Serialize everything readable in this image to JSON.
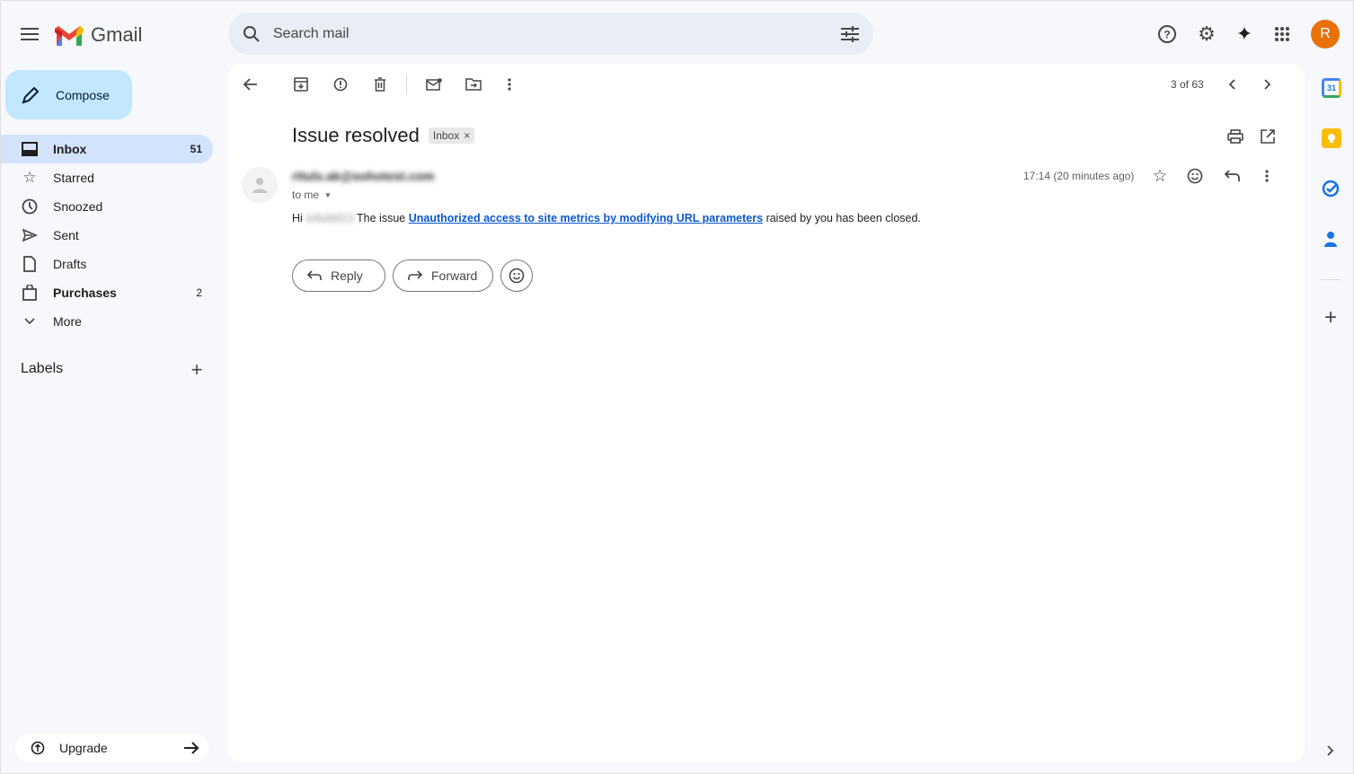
{
  "app": {
    "name": "Gmail",
    "avatar_letter": "R",
    "avatar_color": "#e8710a"
  },
  "search": {
    "placeholder": "Search mail"
  },
  "compose_label": "Compose",
  "sidebar": {
    "items": [
      {
        "label": "Inbox",
        "count": "51",
        "icon": "inbox-icon",
        "active": true
      },
      {
        "label": "Starred",
        "count": "",
        "icon": "star-icon"
      },
      {
        "label": "Snoozed",
        "count": "",
        "icon": "clock-icon"
      },
      {
        "label": "Sent",
        "count": "",
        "icon": "send-icon"
      },
      {
        "label": "Drafts",
        "count": "",
        "icon": "draft-icon"
      },
      {
        "label": "Purchases",
        "count": "2",
        "icon": "bag-icon"
      },
      {
        "label": "More",
        "count": "",
        "icon": "chevron-down-icon"
      }
    ],
    "labels_heading": "Labels",
    "upgrade_label": "Upgrade"
  },
  "toolbar": {
    "pagination": "3 of 63"
  },
  "email": {
    "subject": "Issue resolved",
    "label_chip": "Inbox",
    "sender": "rituls.ak@sohotest.com",
    "recipient": "to me",
    "time": "17:14 (20 minutes ago)",
    "greeting": "Hi",
    "greeting_name": "srituls013",
    "body_prefix": "The issue",
    "link_text": "Unauthorized access to site metrics by modifying URL parameters",
    "body_suffix": "raised by you has been closed."
  },
  "actions": {
    "reply": "Reply",
    "forward": "Forward"
  },
  "colors": {
    "accent": "#0b57d0",
    "compose_bg": "#c2e7ff",
    "active_nav": "#d3e3fd"
  }
}
